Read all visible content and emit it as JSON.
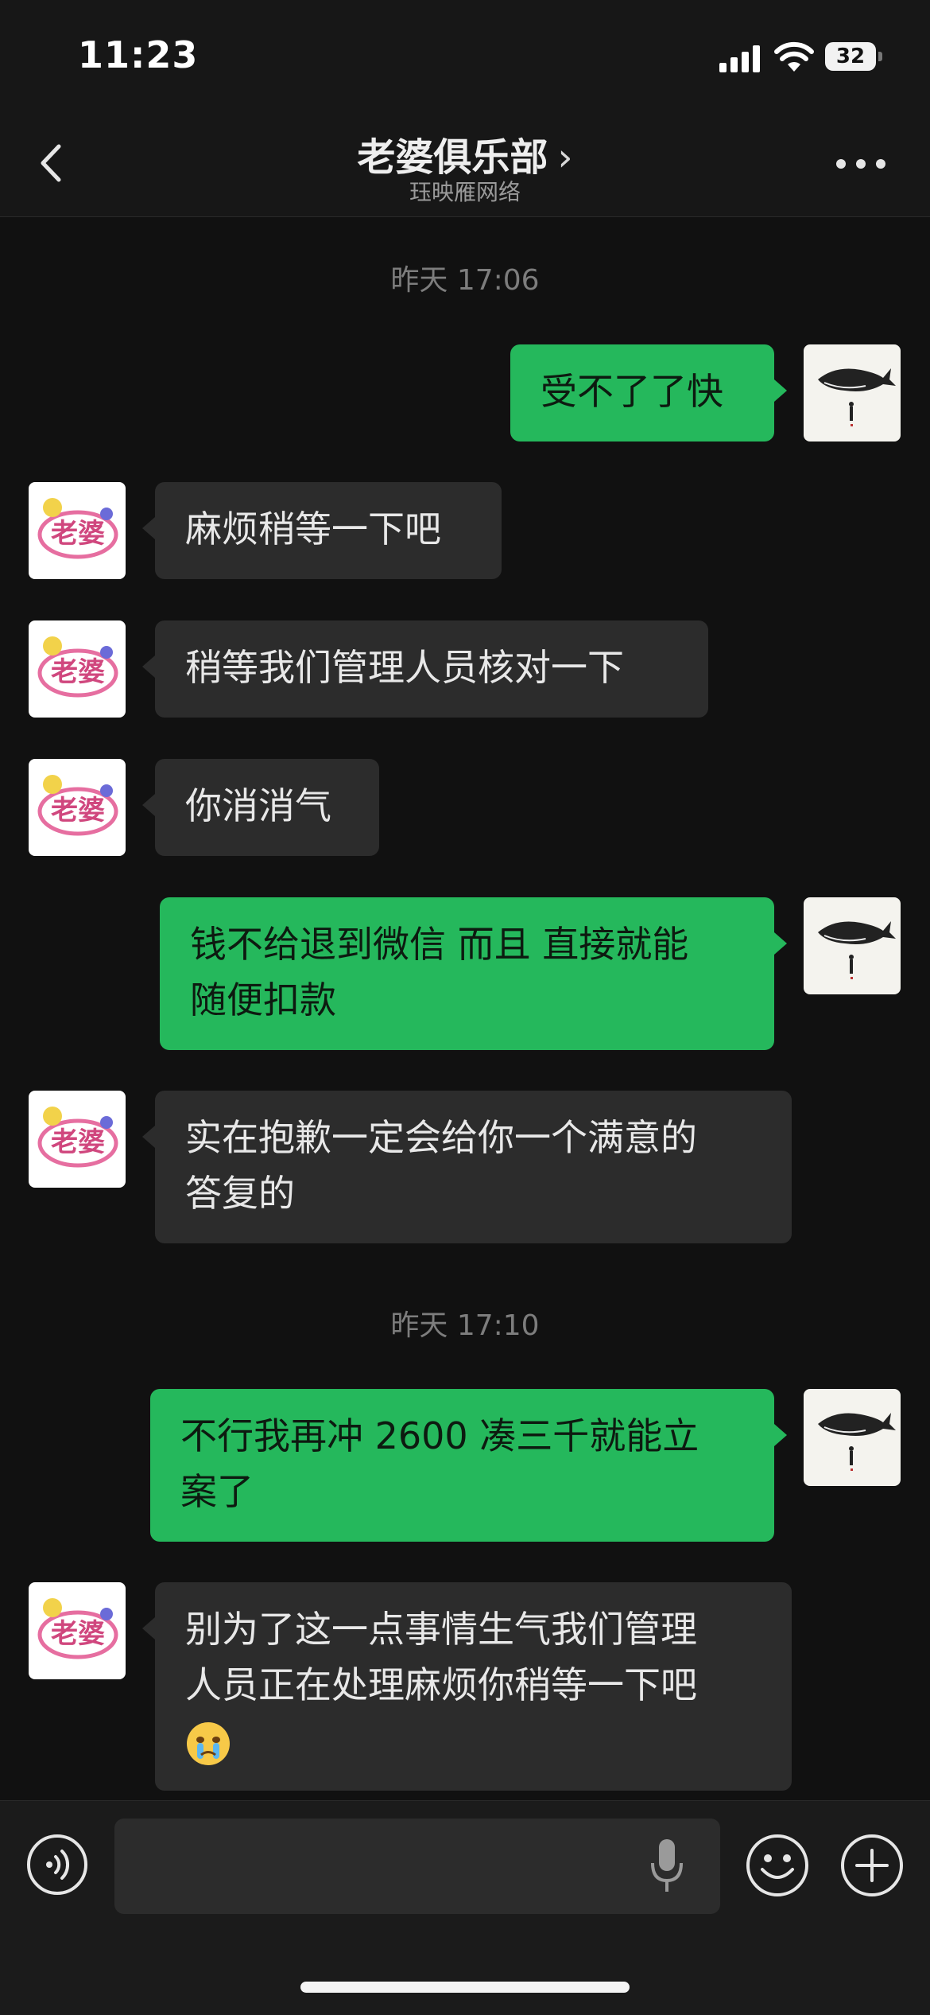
{
  "status_bar": {
    "time": "11:23",
    "battery": "32"
  },
  "header": {
    "title": "老婆俱乐部",
    "title_chevron": "›",
    "subtitle": "珏映雁网络",
    "back_icon": "chevron-left-icon",
    "more_icon": "more-dots-icon"
  },
  "messages": {
    "ts1": "昨天 17:06",
    "m1": "受不了了快",
    "m2": "麻烦稍等一下吧",
    "m3": "稍等我们管理人员核对一下",
    "m4": "你消消气",
    "m5_line1": "钱不给退到微信 而且 直接就能",
    "m5_line2": "随便扣款",
    "m6_line1": "实在抱歉一定会给你一个满意的",
    "m6_line2": "答复的",
    "ts2": "昨天 17:10",
    "m7_line1": "不行我再冲 2600 凑三千就能立",
    "m7_line2": "案了",
    "m8_line1": "别为了这一点事情生气我们管理",
    "m8_line2": "人员正在处理麻烦你稍等一下吧",
    "m8_emoji": "crying-face-emoji"
  },
  "avatars": {
    "me": "whale-avatar",
    "them": "laopo-logo-avatar",
    "them_logo_text": "老婆"
  },
  "input_bar": {
    "voice_icon": "voice-icon",
    "mic_icon": "microphone-icon",
    "emoji_icon": "emoji-icon",
    "plus_icon": "plus-icon"
  },
  "colors": {
    "my_bubble": "#25b85c",
    "their_bubble": "#2c2c2c",
    "background": "#111111"
  }
}
